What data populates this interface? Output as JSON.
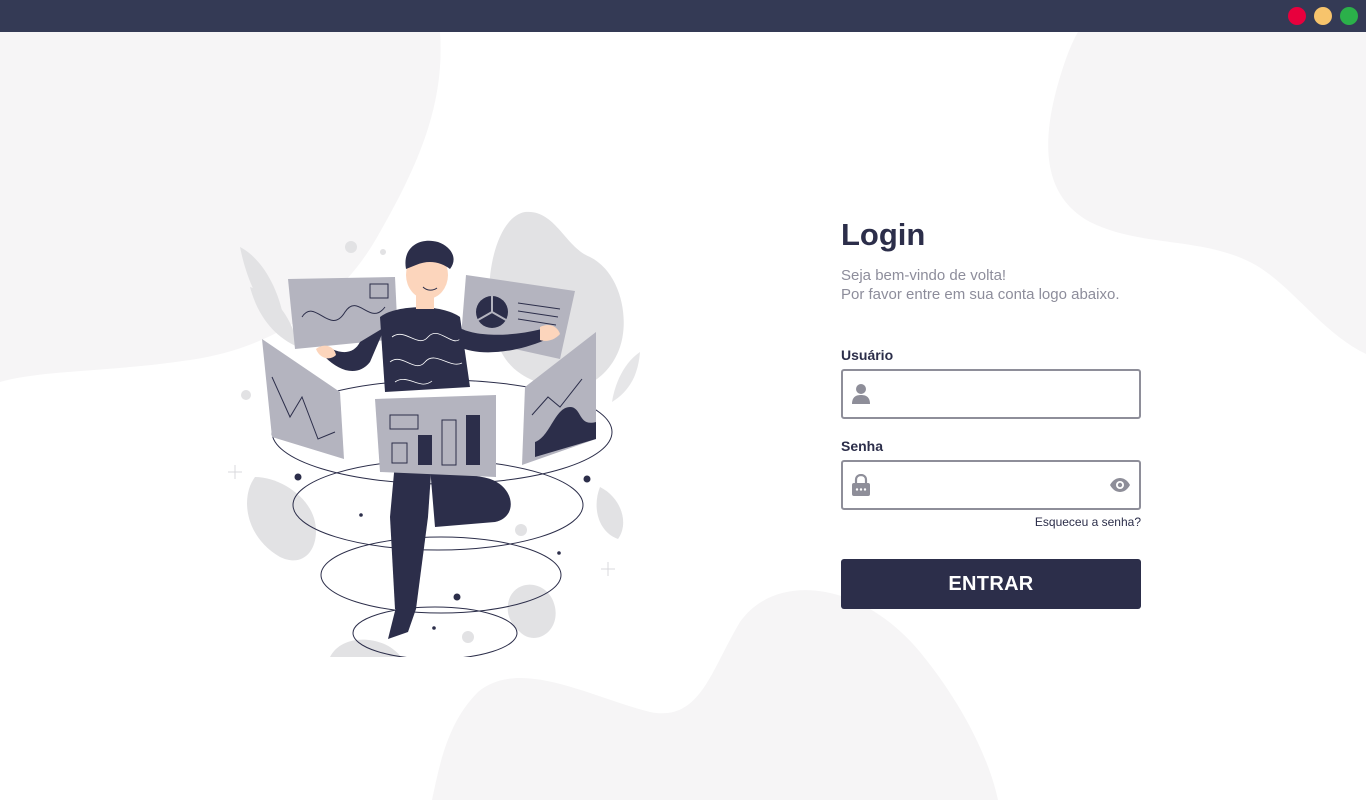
{
  "window": {
    "controls": [
      {
        "name": "close",
        "color": "#e8003d"
      },
      {
        "name": "minimize",
        "color": "#f7c46c"
      },
      {
        "name": "maximize",
        "color": "#2bb04a"
      }
    ]
  },
  "theme": {
    "primary": "#2c2e4a",
    "titlebar": "#343a55",
    "muted_text": "#8d8d9b",
    "blob": "#f6f5f6",
    "illustration_gray": "#b4b4bf"
  },
  "login": {
    "title": "Login",
    "welcome_line1": "Seja bem-vindo de volta!",
    "welcome_line2": "Por favor entre em sua conta logo abaixo.",
    "username": {
      "label": "Usuário",
      "value": "",
      "placeholder": "",
      "icon": "user-icon"
    },
    "password": {
      "label": "Senha",
      "value": "",
      "placeholder": "",
      "icon": "lock-icon",
      "toggle_icon": "eye-icon"
    },
    "forgot_link": "Esqueceu a senha?",
    "submit_label": "ENTRAR"
  }
}
